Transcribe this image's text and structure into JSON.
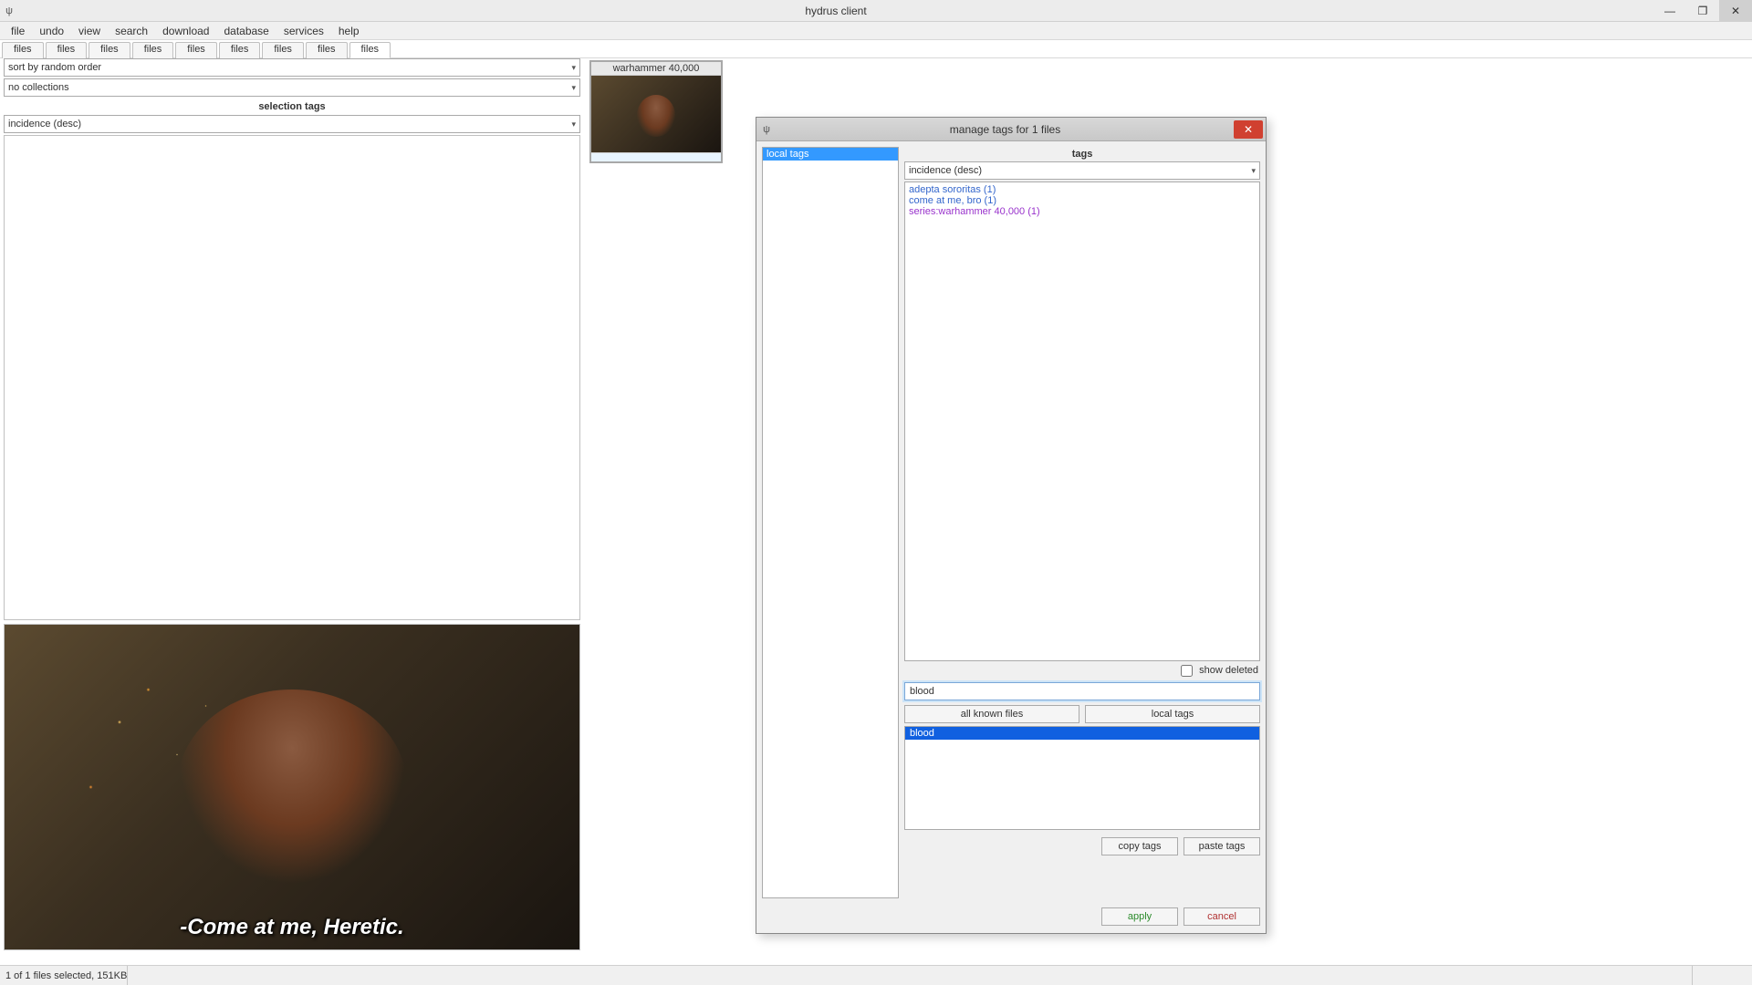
{
  "window": {
    "title": "hydrus client"
  },
  "menu": [
    "file",
    "undo",
    "view",
    "search",
    "download",
    "database",
    "services",
    "help"
  ],
  "tabs": {
    "items": [
      "files",
      "files",
      "files",
      "files",
      "files",
      "files",
      "files",
      "files",
      "files"
    ],
    "active_index": 8
  },
  "left_panel": {
    "sort_dropdown": "sort by random order",
    "collections_dropdown": "no collections",
    "selection_tags_label": "selection tags",
    "tag_sort_dropdown": "incidence (desc)"
  },
  "preview": {
    "caption": "-Come at me, Heretic."
  },
  "thumbnail": {
    "label": "warhammer 40,000"
  },
  "dialog": {
    "title": "manage tags for 1 files",
    "left_items": [
      "local tags"
    ],
    "right": {
      "header": "tags",
      "sort": "incidence (desc)",
      "tags": [
        {
          "text": "adepta sororitas (1)",
          "cls": "tag-blue"
        },
        {
          "text": "come at me, bro (1)",
          "cls": "tag-blue"
        },
        {
          "text": "series:warhammer 40,000 (1)",
          "cls": "tag-purple"
        }
      ],
      "show_deleted": "show deleted",
      "input_value": "blood",
      "btn_all_known": "all known files",
      "btn_local_tags": "local tags",
      "suggestions": [
        "blood"
      ],
      "btn_copy": "copy tags",
      "btn_paste": "paste tags",
      "btn_apply": "apply",
      "btn_cancel": "cancel"
    }
  },
  "statusbar": {
    "text": "1 of 1 files selected, 151KB"
  }
}
